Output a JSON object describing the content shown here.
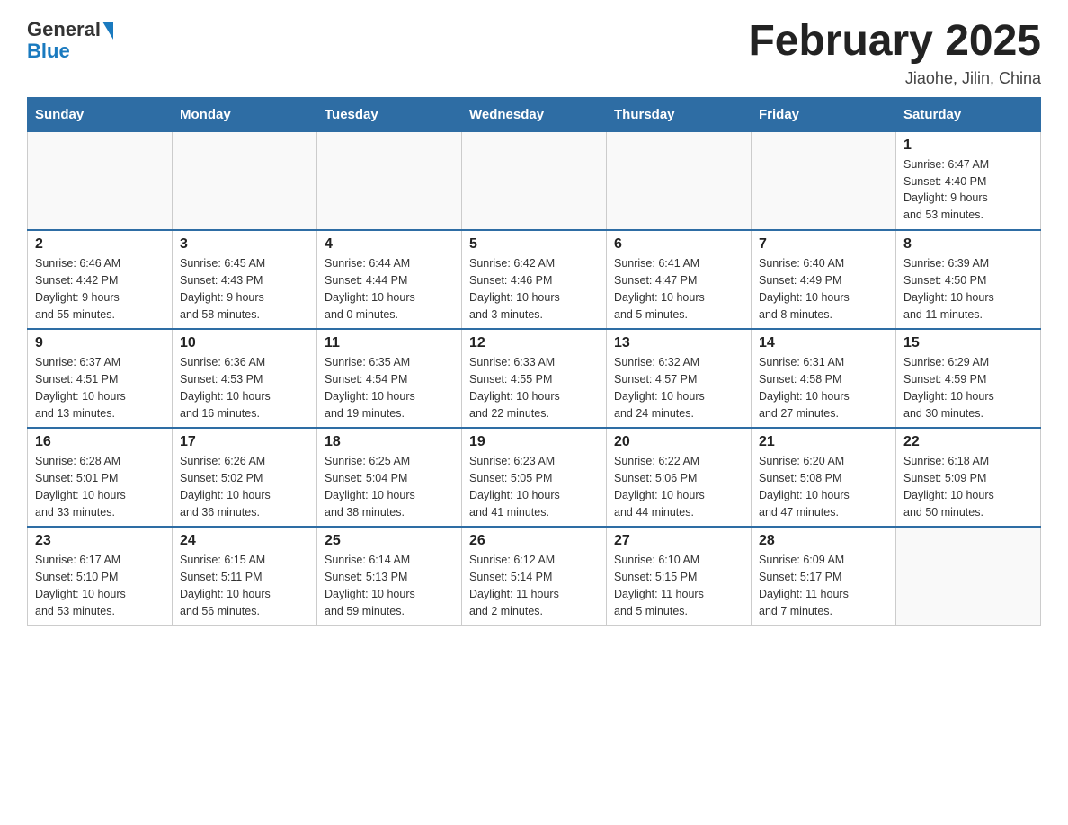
{
  "header": {
    "logo_general": "General",
    "logo_blue": "Blue",
    "month_title": "February 2025",
    "location": "Jiaohe, Jilin, China"
  },
  "weekdays": [
    "Sunday",
    "Monday",
    "Tuesday",
    "Wednesday",
    "Thursday",
    "Friday",
    "Saturday"
  ],
  "weeks": [
    [
      {
        "day": "",
        "info": ""
      },
      {
        "day": "",
        "info": ""
      },
      {
        "day": "",
        "info": ""
      },
      {
        "day": "",
        "info": ""
      },
      {
        "day": "",
        "info": ""
      },
      {
        "day": "",
        "info": ""
      },
      {
        "day": "1",
        "info": "Sunrise: 6:47 AM\nSunset: 4:40 PM\nDaylight: 9 hours\nand 53 minutes."
      }
    ],
    [
      {
        "day": "2",
        "info": "Sunrise: 6:46 AM\nSunset: 4:42 PM\nDaylight: 9 hours\nand 55 minutes."
      },
      {
        "day": "3",
        "info": "Sunrise: 6:45 AM\nSunset: 4:43 PM\nDaylight: 9 hours\nand 58 minutes."
      },
      {
        "day": "4",
        "info": "Sunrise: 6:44 AM\nSunset: 4:44 PM\nDaylight: 10 hours\nand 0 minutes."
      },
      {
        "day": "5",
        "info": "Sunrise: 6:42 AM\nSunset: 4:46 PM\nDaylight: 10 hours\nand 3 minutes."
      },
      {
        "day": "6",
        "info": "Sunrise: 6:41 AM\nSunset: 4:47 PM\nDaylight: 10 hours\nand 5 minutes."
      },
      {
        "day": "7",
        "info": "Sunrise: 6:40 AM\nSunset: 4:49 PM\nDaylight: 10 hours\nand 8 minutes."
      },
      {
        "day": "8",
        "info": "Sunrise: 6:39 AM\nSunset: 4:50 PM\nDaylight: 10 hours\nand 11 minutes."
      }
    ],
    [
      {
        "day": "9",
        "info": "Sunrise: 6:37 AM\nSunset: 4:51 PM\nDaylight: 10 hours\nand 13 minutes."
      },
      {
        "day": "10",
        "info": "Sunrise: 6:36 AM\nSunset: 4:53 PM\nDaylight: 10 hours\nand 16 minutes."
      },
      {
        "day": "11",
        "info": "Sunrise: 6:35 AM\nSunset: 4:54 PM\nDaylight: 10 hours\nand 19 minutes."
      },
      {
        "day": "12",
        "info": "Sunrise: 6:33 AM\nSunset: 4:55 PM\nDaylight: 10 hours\nand 22 minutes."
      },
      {
        "day": "13",
        "info": "Sunrise: 6:32 AM\nSunset: 4:57 PM\nDaylight: 10 hours\nand 24 minutes."
      },
      {
        "day": "14",
        "info": "Sunrise: 6:31 AM\nSunset: 4:58 PM\nDaylight: 10 hours\nand 27 minutes."
      },
      {
        "day": "15",
        "info": "Sunrise: 6:29 AM\nSunset: 4:59 PM\nDaylight: 10 hours\nand 30 minutes."
      }
    ],
    [
      {
        "day": "16",
        "info": "Sunrise: 6:28 AM\nSunset: 5:01 PM\nDaylight: 10 hours\nand 33 minutes."
      },
      {
        "day": "17",
        "info": "Sunrise: 6:26 AM\nSunset: 5:02 PM\nDaylight: 10 hours\nand 36 minutes."
      },
      {
        "day": "18",
        "info": "Sunrise: 6:25 AM\nSunset: 5:04 PM\nDaylight: 10 hours\nand 38 minutes."
      },
      {
        "day": "19",
        "info": "Sunrise: 6:23 AM\nSunset: 5:05 PM\nDaylight: 10 hours\nand 41 minutes."
      },
      {
        "day": "20",
        "info": "Sunrise: 6:22 AM\nSunset: 5:06 PM\nDaylight: 10 hours\nand 44 minutes."
      },
      {
        "day": "21",
        "info": "Sunrise: 6:20 AM\nSunset: 5:08 PM\nDaylight: 10 hours\nand 47 minutes."
      },
      {
        "day": "22",
        "info": "Sunrise: 6:18 AM\nSunset: 5:09 PM\nDaylight: 10 hours\nand 50 minutes."
      }
    ],
    [
      {
        "day": "23",
        "info": "Sunrise: 6:17 AM\nSunset: 5:10 PM\nDaylight: 10 hours\nand 53 minutes."
      },
      {
        "day": "24",
        "info": "Sunrise: 6:15 AM\nSunset: 5:11 PM\nDaylight: 10 hours\nand 56 minutes."
      },
      {
        "day": "25",
        "info": "Sunrise: 6:14 AM\nSunset: 5:13 PM\nDaylight: 10 hours\nand 59 minutes."
      },
      {
        "day": "26",
        "info": "Sunrise: 6:12 AM\nSunset: 5:14 PM\nDaylight: 11 hours\nand 2 minutes."
      },
      {
        "day": "27",
        "info": "Sunrise: 6:10 AM\nSunset: 5:15 PM\nDaylight: 11 hours\nand 5 minutes."
      },
      {
        "day": "28",
        "info": "Sunrise: 6:09 AM\nSunset: 5:17 PM\nDaylight: 11 hours\nand 7 minutes."
      },
      {
        "day": "",
        "info": ""
      }
    ]
  ]
}
